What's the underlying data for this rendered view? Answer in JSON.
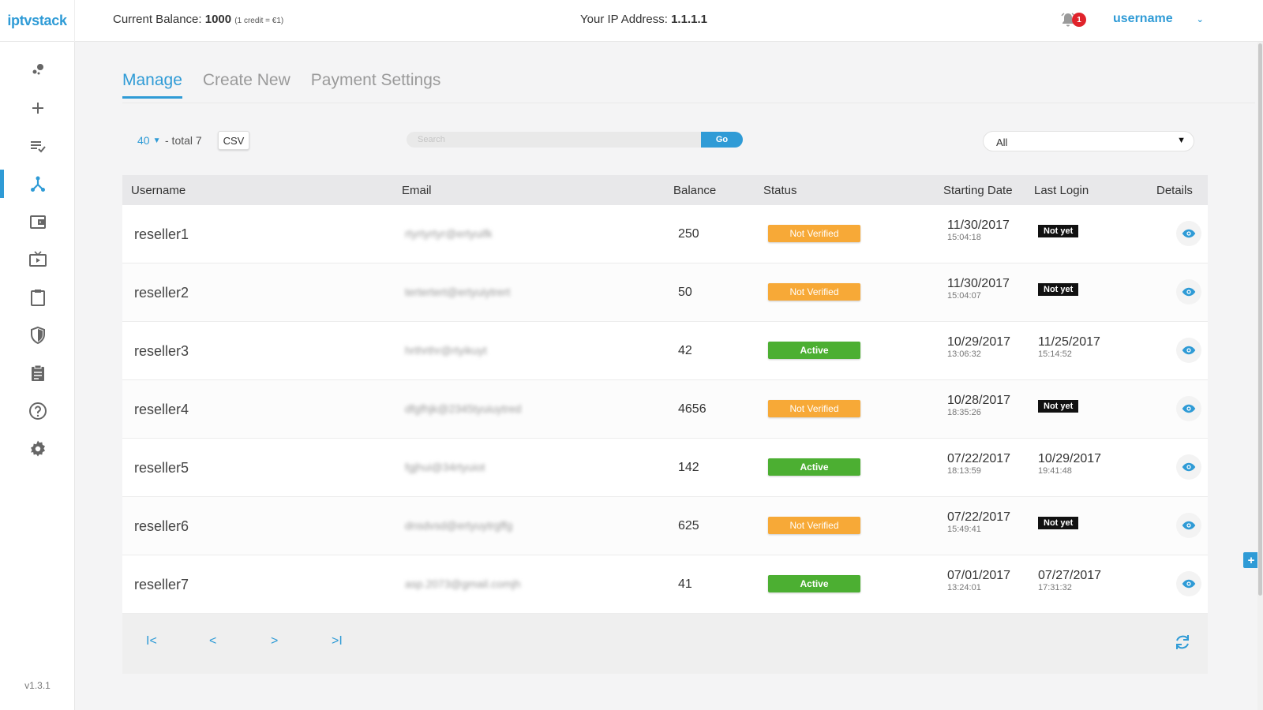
{
  "header": {
    "logo": "iptvstack",
    "balance_label": "Current Balance:",
    "balance_value": "1000",
    "balance_note": "(1 credit = €1)",
    "ip_label": "Your IP Address:",
    "ip_value": "1.1.1.1",
    "notification_count": "1",
    "username": "username"
  },
  "sidebar": {
    "items": [
      {
        "icon": "dashboard-icon"
      },
      {
        "icon": "plus-icon"
      },
      {
        "icon": "list-check-icon"
      },
      {
        "icon": "resellers-icon",
        "active": true
      },
      {
        "icon": "wallet-icon"
      },
      {
        "icon": "tv-icon"
      },
      {
        "icon": "clipboard-icon"
      },
      {
        "icon": "shield-icon"
      },
      {
        "icon": "report-icon"
      },
      {
        "icon": "help-icon"
      },
      {
        "icon": "settings-icon"
      }
    ],
    "version": "v1.3.1"
  },
  "tabs": [
    "Manage",
    "Create New",
    "Payment Settings"
  ],
  "controls": {
    "page_size": "40",
    "total": "- total 7",
    "csv_label": "CSV",
    "search_placeholder": "Search",
    "go_label": "Go",
    "filter_value": "All"
  },
  "table": {
    "headers": [
      "Username",
      "Email",
      "Balance",
      "Status",
      "Starting Date",
      "Last Login",
      "Details"
    ],
    "rows": [
      {
        "username": "reseller1",
        "email": "rtyrtyrtyr@ertyuifk",
        "balance": "250",
        "status": "Not Verified",
        "status_type": "notverified",
        "start_date": "11/30/2017",
        "start_time": "15:04:18",
        "last_date": "",
        "last_time": "",
        "last_badge": "Not yet"
      },
      {
        "username": "reseller2",
        "email": "tertertert@ertyuiytrert",
        "balance": "50",
        "status": "Not Verified",
        "status_type": "notverified",
        "start_date": "11/30/2017",
        "start_time": "15:04:07",
        "last_date": "",
        "last_time": "",
        "last_badge": "Not yet"
      },
      {
        "username": "reseller3",
        "email": "hrthrthr@rtyikuyt",
        "balance": "42",
        "status": "Active",
        "status_type": "active",
        "start_date": "10/29/2017",
        "start_time": "13:06:32",
        "last_date": "11/25/2017",
        "last_time": "15:14:52",
        "last_badge": ""
      },
      {
        "username": "reseller4",
        "email": "dfgfhjk@2345tyuiuytred",
        "balance": "4656",
        "status": "Not Verified",
        "status_type": "notverified",
        "start_date": "10/28/2017",
        "start_time": "18:35:26",
        "last_date": "",
        "last_time": "",
        "last_badge": "Not yet"
      },
      {
        "username": "reseller5",
        "email": "fgjhui@34rtyuiot",
        "balance": "142",
        "status": "Active",
        "status_type": "active",
        "start_date": "07/22/2017",
        "start_time": "18:13:59",
        "last_date": "10/29/2017",
        "last_time": "19:41:48",
        "last_badge": ""
      },
      {
        "username": "reseller6",
        "email": "dnsdvsd@ertyuytrgffg",
        "balance": "625",
        "status": "Not Verified",
        "status_type": "notverified",
        "start_date": "07/22/2017",
        "start_time": "15:49:41",
        "last_date": "",
        "last_time": "",
        "last_badge": "Not yet"
      },
      {
        "username": "reseller7",
        "email": "asp.2073@gmail.comjh",
        "balance": "41",
        "status": "Active",
        "status_type": "active",
        "start_date": "07/01/2017",
        "start_time": "13:24:01",
        "last_date": "07/27/2017",
        "last_time": "17:31:32",
        "last_badge": ""
      }
    ]
  },
  "pagination": {
    "first": "I<",
    "prev": "<",
    "next": ">",
    "last": ">I"
  },
  "float_button": "+",
  "colors": {
    "accent": "#2f9bd6",
    "not_verified": "#f7a937",
    "active": "#4caf32",
    "badge_red": "#e0232b"
  }
}
